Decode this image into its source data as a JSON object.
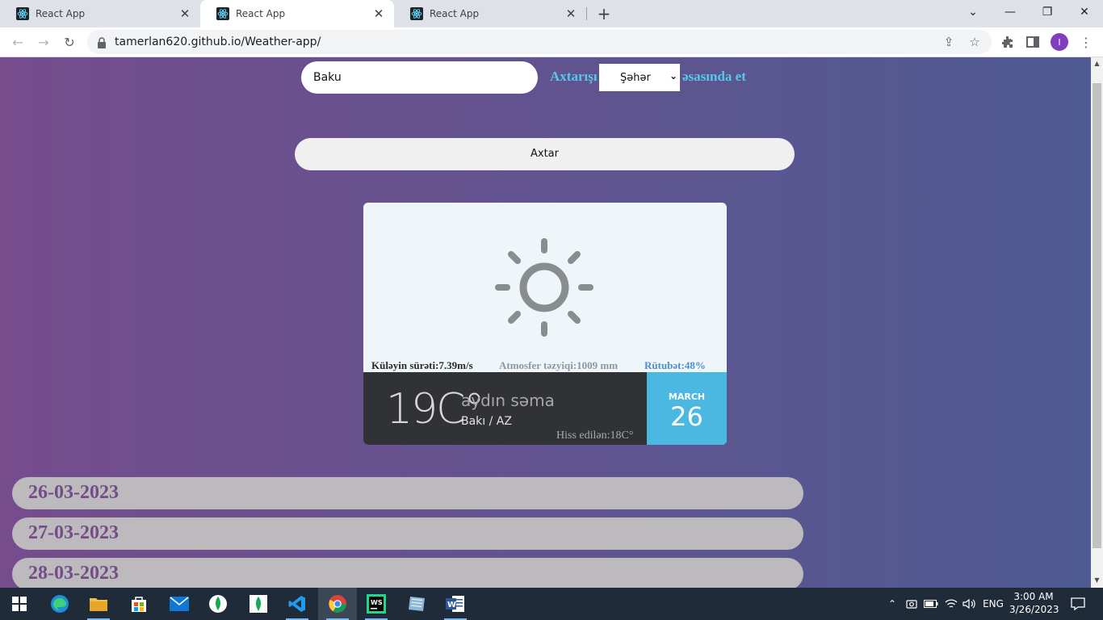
{
  "browser": {
    "tabs": [
      {
        "title": "React App"
      },
      {
        "title": "React App"
      },
      {
        "title": "React App"
      }
    ],
    "url": "tamerlan620.github.io/Weather-app/",
    "profile_initial": "I"
  },
  "search": {
    "input_value": "Baku",
    "label_before": "Axtarışı",
    "mode_value": "Şəhər",
    "label_after": "əsasında et",
    "button_label": "Axtar"
  },
  "weather": {
    "icon": "sun-icon",
    "wind": "Küləyin sürəti:7.39m/s",
    "pressure": "Atmosfer təzyiqi:1009 mm",
    "humidity": "Rütubət:48%",
    "temperature": "19C°",
    "description": "aydın səma",
    "city": "Bakı / AZ",
    "feels_like": "Hiss edilən:18C°",
    "month": "MARCH",
    "day": "26",
    "colors": {
      "wind": "#2b2b2b",
      "pressure": "#8c98a8",
      "humidity": "#4f8fd0",
      "date_box": "#4bb8e2"
    }
  },
  "forecast": [
    {
      "date": "26-03-2023"
    },
    {
      "date": "27-03-2023"
    },
    {
      "date": "28-03-2023"
    }
  ],
  "taskbar": {
    "language": "ENG",
    "time": "3:00 AM",
    "date": "3/26/2023"
  }
}
